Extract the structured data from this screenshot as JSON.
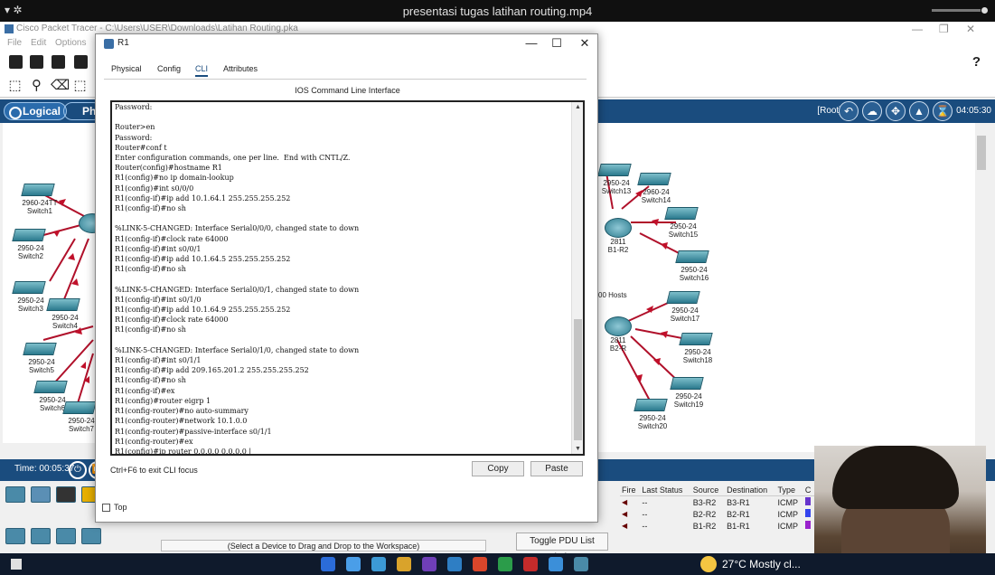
{
  "video": {
    "title": "presentasi tugas latihan routing.mp4"
  },
  "pt": {
    "window_title": "Cisco Packet Tracer - C:\\Users\\USER\\Downloads\\Latihan Routing.pka",
    "menu": [
      "File",
      "Edit",
      "Options"
    ],
    "help_glyph": "?",
    "logical_label": "Logical",
    "physical_label": "Ph",
    "root_label": "[Root]",
    "clock": "04:05:30",
    "time_label": "Time: 00:05:37",
    "status_footer": "(Select a Device to Drag and Drop to the Workspace)",
    "toggle_pdu": "Toggle PDU List Window"
  },
  "devices": {
    "s1": {
      "model": "2960-24TT",
      "name": "Switch1"
    },
    "s2": {
      "model": "2950-24",
      "name": "Switch2"
    },
    "s3": {
      "model": "2950-24",
      "name": "Switch3"
    },
    "s4": {
      "model": "2950-24",
      "name": "Switch4"
    },
    "s5": {
      "model": "2950-24",
      "name": "Switch5"
    },
    "s6": {
      "model": "2950-24",
      "name": "Switch6"
    },
    "s7": {
      "model": "2950-24",
      "name": "Switch7"
    },
    "s13": {
      "model": "2950-24",
      "name": "Switch13"
    },
    "s14": {
      "model": "2960-24",
      "name": "Switch14"
    },
    "s15": {
      "model": "2950-24",
      "name": "Switch15"
    },
    "s16": {
      "model": "2950-24",
      "name": "Switch16"
    },
    "s17": {
      "model": "2950-24",
      "name": "Switch17"
    },
    "s18": {
      "model": "2950-24",
      "name": "Switch18"
    },
    "s19": {
      "model": "2950-24",
      "name": "Switch19"
    },
    "s20": {
      "model": "2950-24",
      "name": "Switch20"
    },
    "r_b1r2": {
      "model": "2811",
      "name": "B1-R2"
    },
    "r_b2r": {
      "model": "2811",
      "name": "B2-R"
    },
    "hosts_label": "00 Hosts"
  },
  "pdu": {
    "headers": [
      "Fire",
      "Last Status",
      "Source",
      "Destination",
      "Type",
      "C"
    ],
    "rows": [
      {
        "status": "--",
        "source": "B3-R2",
        "destination": "B3-R1",
        "type": "ICMP",
        "color": "#6633cc"
      },
      {
        "status": "--",
        "source": "B2-R2",
        "destination": "B2-R1",
        "type": "ICMP",
        "color": "#3344ee"
      },
      {
        "status": "--",
        "source": "B1-R2",
        "destination": "B1-R1",
        "type": "ICMP",
        "color": "#9922cc"
      }
    ]
  },
  "dialog": {
    "title": "R1",
    "tabs": [
      "Physical",
      "Config",
      "CLI",
      "Attributes"
    ],
    "active_tab": "CLI",
    "cli_header": "IOS Command Line Interface",
    "terminal_lines": [
      "Password:",
      "",
      "Router>en",
      "Password:",
      "Router#conf t",
      "Enter configuration commands, one per line.  End with CNTL/Z.",
      "Router(config)#hostname R1",
      "R1(config)#no ip domain-lookup",
      "R1(config)#int s0/0/0",
      "R1(config-if)#ip add 10.1.64.1 255.255.255.252",
      "R1(config-if)#no sh",
      "",
      "%LINK-5-CHANGED: Interface Serial0/0/0, changed state to down",
      "R1(config-if)#clock rate 64000",
      "R1(config-if)#int s0/0/1",
      "R1(config-if)#ip add 10.1.64.5 255.255.255.252",
      "R1(config-if)#no sh",
      "",
      "%LINK-5-CHANGED: Interface Serial0/0/1, changed state to down",
      "R1(config-if)#int s0/1/0",
      "R1(config-if)#ip add 10.1.64.9 255.255.255.252",
      "R1(config-if)#clock rate 64000",
      "R1(config-if)#no sh",
      "",
      "%LINK-5-CHANGED: Interface Serial0/1/0, changed state to down",
      "R1(config-if)#int s0/1/1",
      "R1(config-if)#ip add 209.165.201.2 255.255.255.252",
      "R1(config-if)#no sh",
      "R1(config-if)#ex",
      "R1(config)#router eigrp 1",
      "R1(config-router)#no auto-summary",
      "R1(config-router)#network 10.1.0.0",
      "R1(config-router)#passive-interface s0/1/1",
      "R1(config-router)#ex",
      "R1(config)#ip router 0.0.0.0 0.0.0.0 |"
    ],
    "hint": "Ctrl+F6 to exit CLI focus",
    "copy_label": "Copy",
    "paste_label": "Paste",
    "top_label": "Top"
  },
  "taskbar": {
    "weather": "27°C  Mostly cl..."
  }
}
